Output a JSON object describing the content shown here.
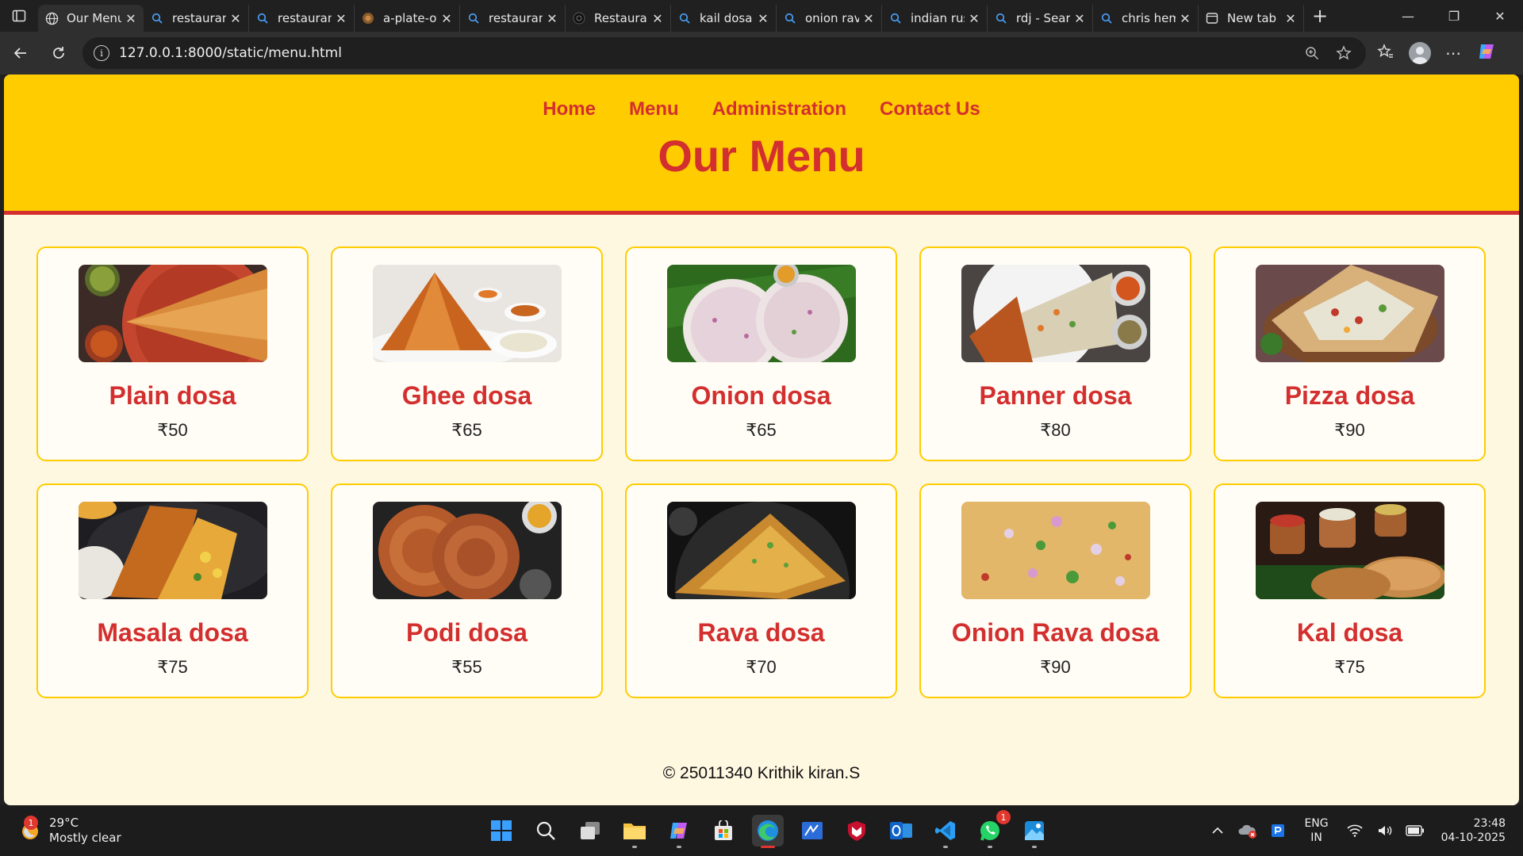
{
  "browser": {
    "tabs": [
      {
        "label": "Our Menu",
        "icon": "globe-icon",
        "active": true
      },
      {
        "label": "restaurant",
        "icon": "search-icon"
      },
      {
        "label": "restaurant",
        "icon": "search-icon"
      },
      {
        "label": "a-plate-of",
        "icon": "image-favicon"
      },
      {
        "label": "restaurant",
        "icon": "search-icon"
      },
      {
        "label": "Restaurant",
        "icon": "site-favicon"
      },
      {
        "label": "kail dosa",
        "icon": "search-icon"
      },
      {
        "label": "onion rava",
        "icon": "search-icon"
      },
      {
        "label": "indian rus",
        "icon": "search-icon"
      },
      {
        "label": "rdj - Sear",
        "icon": "search-icon"
      },
      {
        "label": "chris hem",
        "icon": "search-icon"
      },
      {
        "label": "New tab",
        "icon": "newtab-icon"
      }
    ],
    "url": "127.0.0.1:8000/static/menu.html"
  },
  "site": {
    "nav": {
      "home": "Home",
      "menu": "Menu",
      "administration": "Administration",
      "contact": "Contact Us"
    },
    "title": "Our Menu",
    "items": [
      {
        "name": "Plain dosa",
        "price": "₹50"
      },
      {
        "name": "Ghee dosa",
        "price": "₹65"
      },
      {
        "name": "Onion dosa",
        "price": "₹65"
      },
      {
        "name": "Panner dosa",
        "price": "₹80"
      },
      {
        "name": "Pizza dosa",
        "price": "₹90"
      },
      {
        "name": "Masala dosa",
        "price": "₹75"
      },
      {
        "name": "Podi dosa",
        "price": "₹55"
      },
      {
        "name": "Rava dosa",
        "price": "₹70"
      },
      {
        "name": "Onion Rava dosa",
        "price": "₹90"
      },
      {
        "name": "Kal dosa",
        "price": "₹75"
      }
    ],
    "footer": "© 25011340 Krithik kiran.S"
  },
  "taskbar": {
    "weather": {
      "temp": "29°C",
      "condition": "Mostly clear",
      "badge": "1"
    },
    "whatsapp_badge": "1",
    "lang": {
      "line1": "ENG",
      "line2": "IN"
    },
    "clock": {
      "time": "23:48",
      "date": "04-10-2025"
    }
  },
  "colors": {
    "header": "#ffcc00",
    "accent": "#d32f2f",
    "page_bg": "#fff8e1"
  }
}
